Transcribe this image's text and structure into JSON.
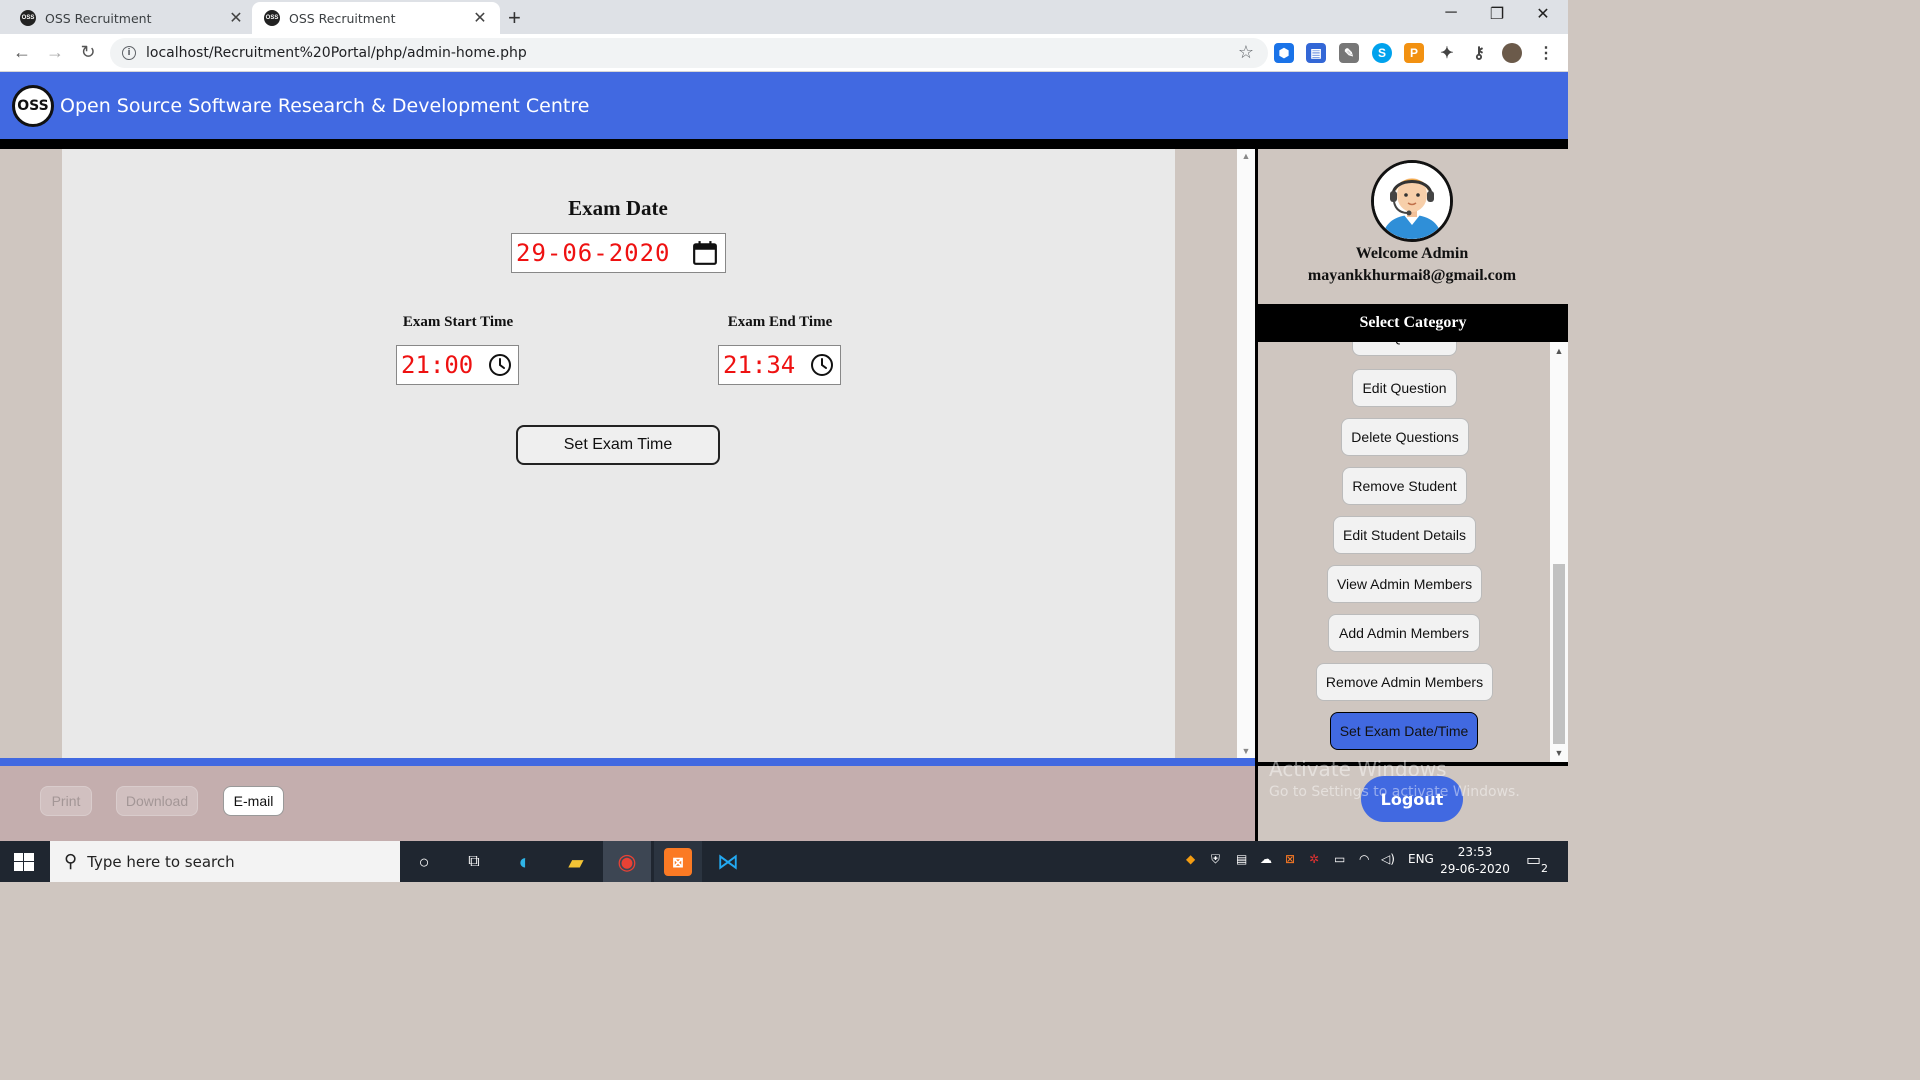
{
  "browser": {
    "tabs": [
      {
        "label": "OSS Recruitment",
        "active": false
      },
      {
        "label": "OSS Recruitment",
        "active": true
      }
    ],
    "favicon_text": "OSS",
    "url": "localhost/Recruitment%20Portal/php/admin-home.php"
  },
  "header": {
    "logo_text": "OSS",
    "title": "Open Source Software Research & Development Centre"
  },
  "form": {
    "exam_date_label": "Exam Date",
    "exam_date_value": "29-06-2020",
    "start_label": "Exam Start Time",
    "start_value": "21:00",
    "end_label": "Exam End Time",
    "end_value": "21:34",
    "submit_label": "Set Exam Time"
  },
  "sidebar": {
    "welcome": "Welcome Admin",
    "email": "mayankkhurmai8@gmail.com",
    "category_header": "Select Category",
    "menu": [
      {
        "label": "Add Question"
      },
      {
        "label": "Edit Question"
      },
      {
        "label": "Delete Questions"
      },
      {
        "label": "Remove Student"
      },
      {
        "label": "Edit Student Details"
      },
      {
        "label": "View Admin Members"
      },
      {
        "label": "Add Admin Members"
      },
      {
        "label": "Remove Admin Members"
      },
      {
        "label": "Set Exam Date/Time",
        "active": true
      }
    ],
    "logout_label": "Logout"
  },
  "footer": {
    "print_label": "Print",
    "download_label": "Download",
    "email_label": "E-mail"
  },
  "watermark": {
    "line1": "Activate Windows",
    "line2": "Go to Settings to activate Windows."
  },
  "taskbar": {
    "search_placeholder": "Type here to search",
    "language": "ENG",
    "time": "23:53",
    "date": "29-06-2020",
    "notification_count": "2"
  },
  "colors": {
    "brand_blue": "#4169e1",
    "value_red": "#ee1111"
  }
}
